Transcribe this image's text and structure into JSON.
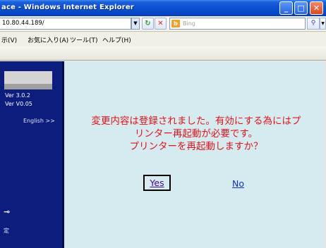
{
  "window": {
    "title": "ace - Windows Internet Explorer",
    "min_glyph": "_",
    "max_glyph": "□",
    "close_glyph": "✕"
  },
  "address_bar": {
    "url": "10.80.44.189/",
    "refresh_glyph": "↻",
    "stop_glyph": "✕",
    "dropdown_glyph": "▼"
  },
  "search": {
    "placeholder": "Bing",
    "logo_glyph": "b",
    "go_glyph": "⚲",
    "dropdown_glyph": "▼"
  },
  "menu": {
    "items": [
      "示(V)",
      "お気に入り(A)",
      "ツール(T)",
      "ヘルプ(H)"
    ]
  },
  "sidebar": {
    "version1": "Ver 3.0.2",
    "version2": "Ver V0.05",
    "english_link": "English >>",
    "key_glyph": "⊸",
    "setting_label": "定"
  },
  "dialog": {
    "message_lines": [
      "変更内容は登録されました。有効にする為にはプ",
      "リンター再起動が必要です。",
      "プリンターを再起動しますか？"
    ],
    "yes_label": "Yes",
    "no_label": "No"
  },
  "colors": {
    "sidebar_bg": "#0c1d7d",
    "content_bg": "#d5ebef",
    "message_color": "#e0141a",
    "titlebar_blue": "#0a50d0"
  }
}
